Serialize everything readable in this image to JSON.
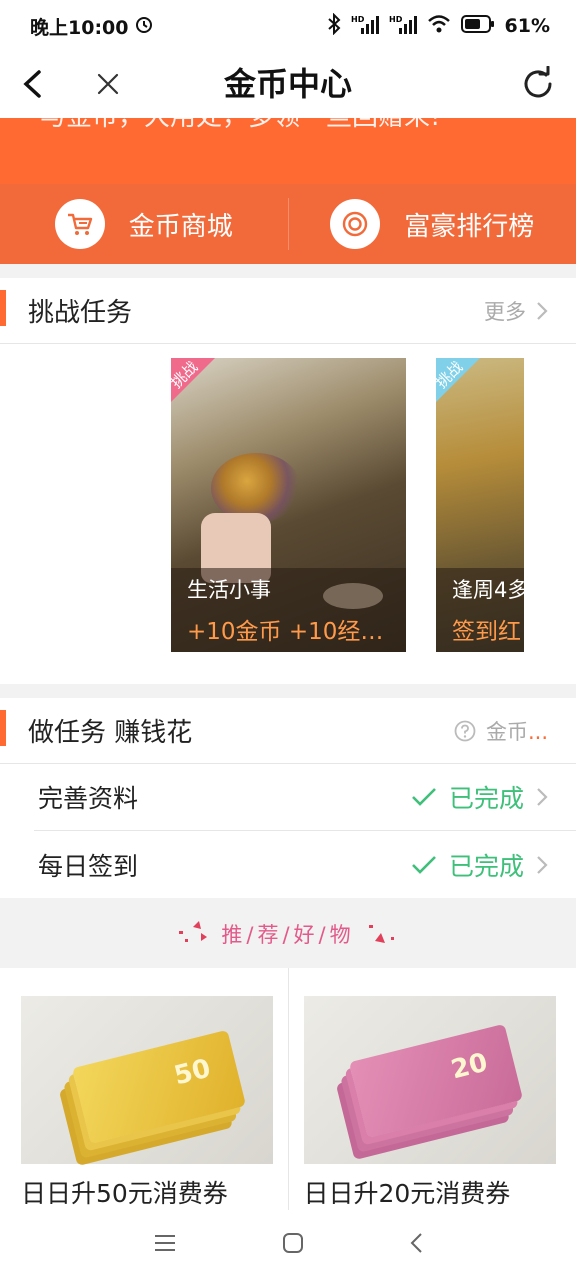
{
  "status_bar": {
    "time": "晚上10:00",
    "battery": "61%",
    "signal_label_1": "HD",
    "signal_label_2": "HD"
  },
  "nav": {
    "title": "金币中心"
  },
  "banner": {
    "text": "与金币，大用处，多领一些回赠来!"
  },
  "quick_links": [
    {
      "label": "金币商城",
      "icon": "cart-icon"
    },
    {
      "label": "富豪排行榜",
      "icon": "coin-icon"
    }
  ],
  "challenge": {
    "title": "挑战任务",
    "more": "更多",
    "cards": [
      {
        "badge": "挑战",
        "name": "生活小事",
        "reward": "+10金币 +10经…"
      },
      {
        "badge": "挑战",
        "name": "逢周4多",
        "reward": "签到红"
      }
    ]
  },
  "tasks": {
    "title": "做任务 赚钱花",
    "help": "金币",
    "help_more": "...",
    "items": [
      {
        "label": "完善资料",
        "status": "已完成"
      },
      {
        "label": "每日签到",
        "status": "已完成"
      }
    ]
  },
  "recommend": {
    "title": "推/荐/好/物",
    "products": [
      {
        "name": "日日升50元消费券",
        "value": "50"
      },
      {
        "name": "日日升20元消费券",
        "value": "20"
      }
    ]
  },
  "colors": {
    "accent": "#ff6a33",
    "success": "#3ec07a"
  }
}
